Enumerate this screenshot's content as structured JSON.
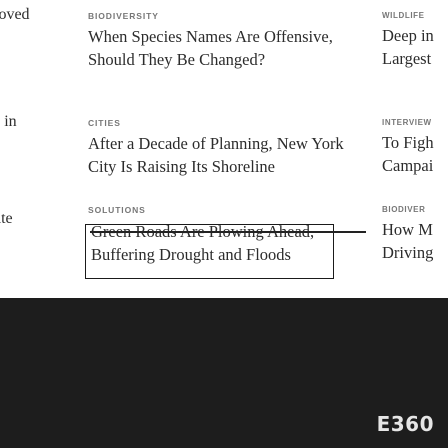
{
  "left_column": {
    "fragments": [
      "loved",
      "s in",
      "ate"
    ]
  },
  "center_column": {
    "stories": [
      {
        "kicker": "BIODIVERSITY",
        "headline": "When Species Names Are Offensive, Should They Be Changed?"
      },
      {
        "kicker": "CITIES",
        "headline": "After a Decade of Planning, New York City Is Raising Its Shoreline"
      }
    ],
    "solutions": {
      "kicker": "SOLUTIONS",
      "headline_line1": "Green Roads Are Plowing Ahead,",
      "headline_line2": "Buffering Drought and Floods"
    }
  },
  "right_column": {
    "stories": [
      {
        "kicker": "WILDLIFE",
        "line1": "Deep in",
        "line2": "Largest"
      },
      {
        "kicker": "INTERVIEW",
        "line1": "To Figh",
        "line2": "Campai"
      },
      {
        "kicker": "BIODIVER",
        "line1": "How M",
        "line2": "Driving"
      }
    ]
  },
  "footer": {
    "logo": "E360"
  }
}
